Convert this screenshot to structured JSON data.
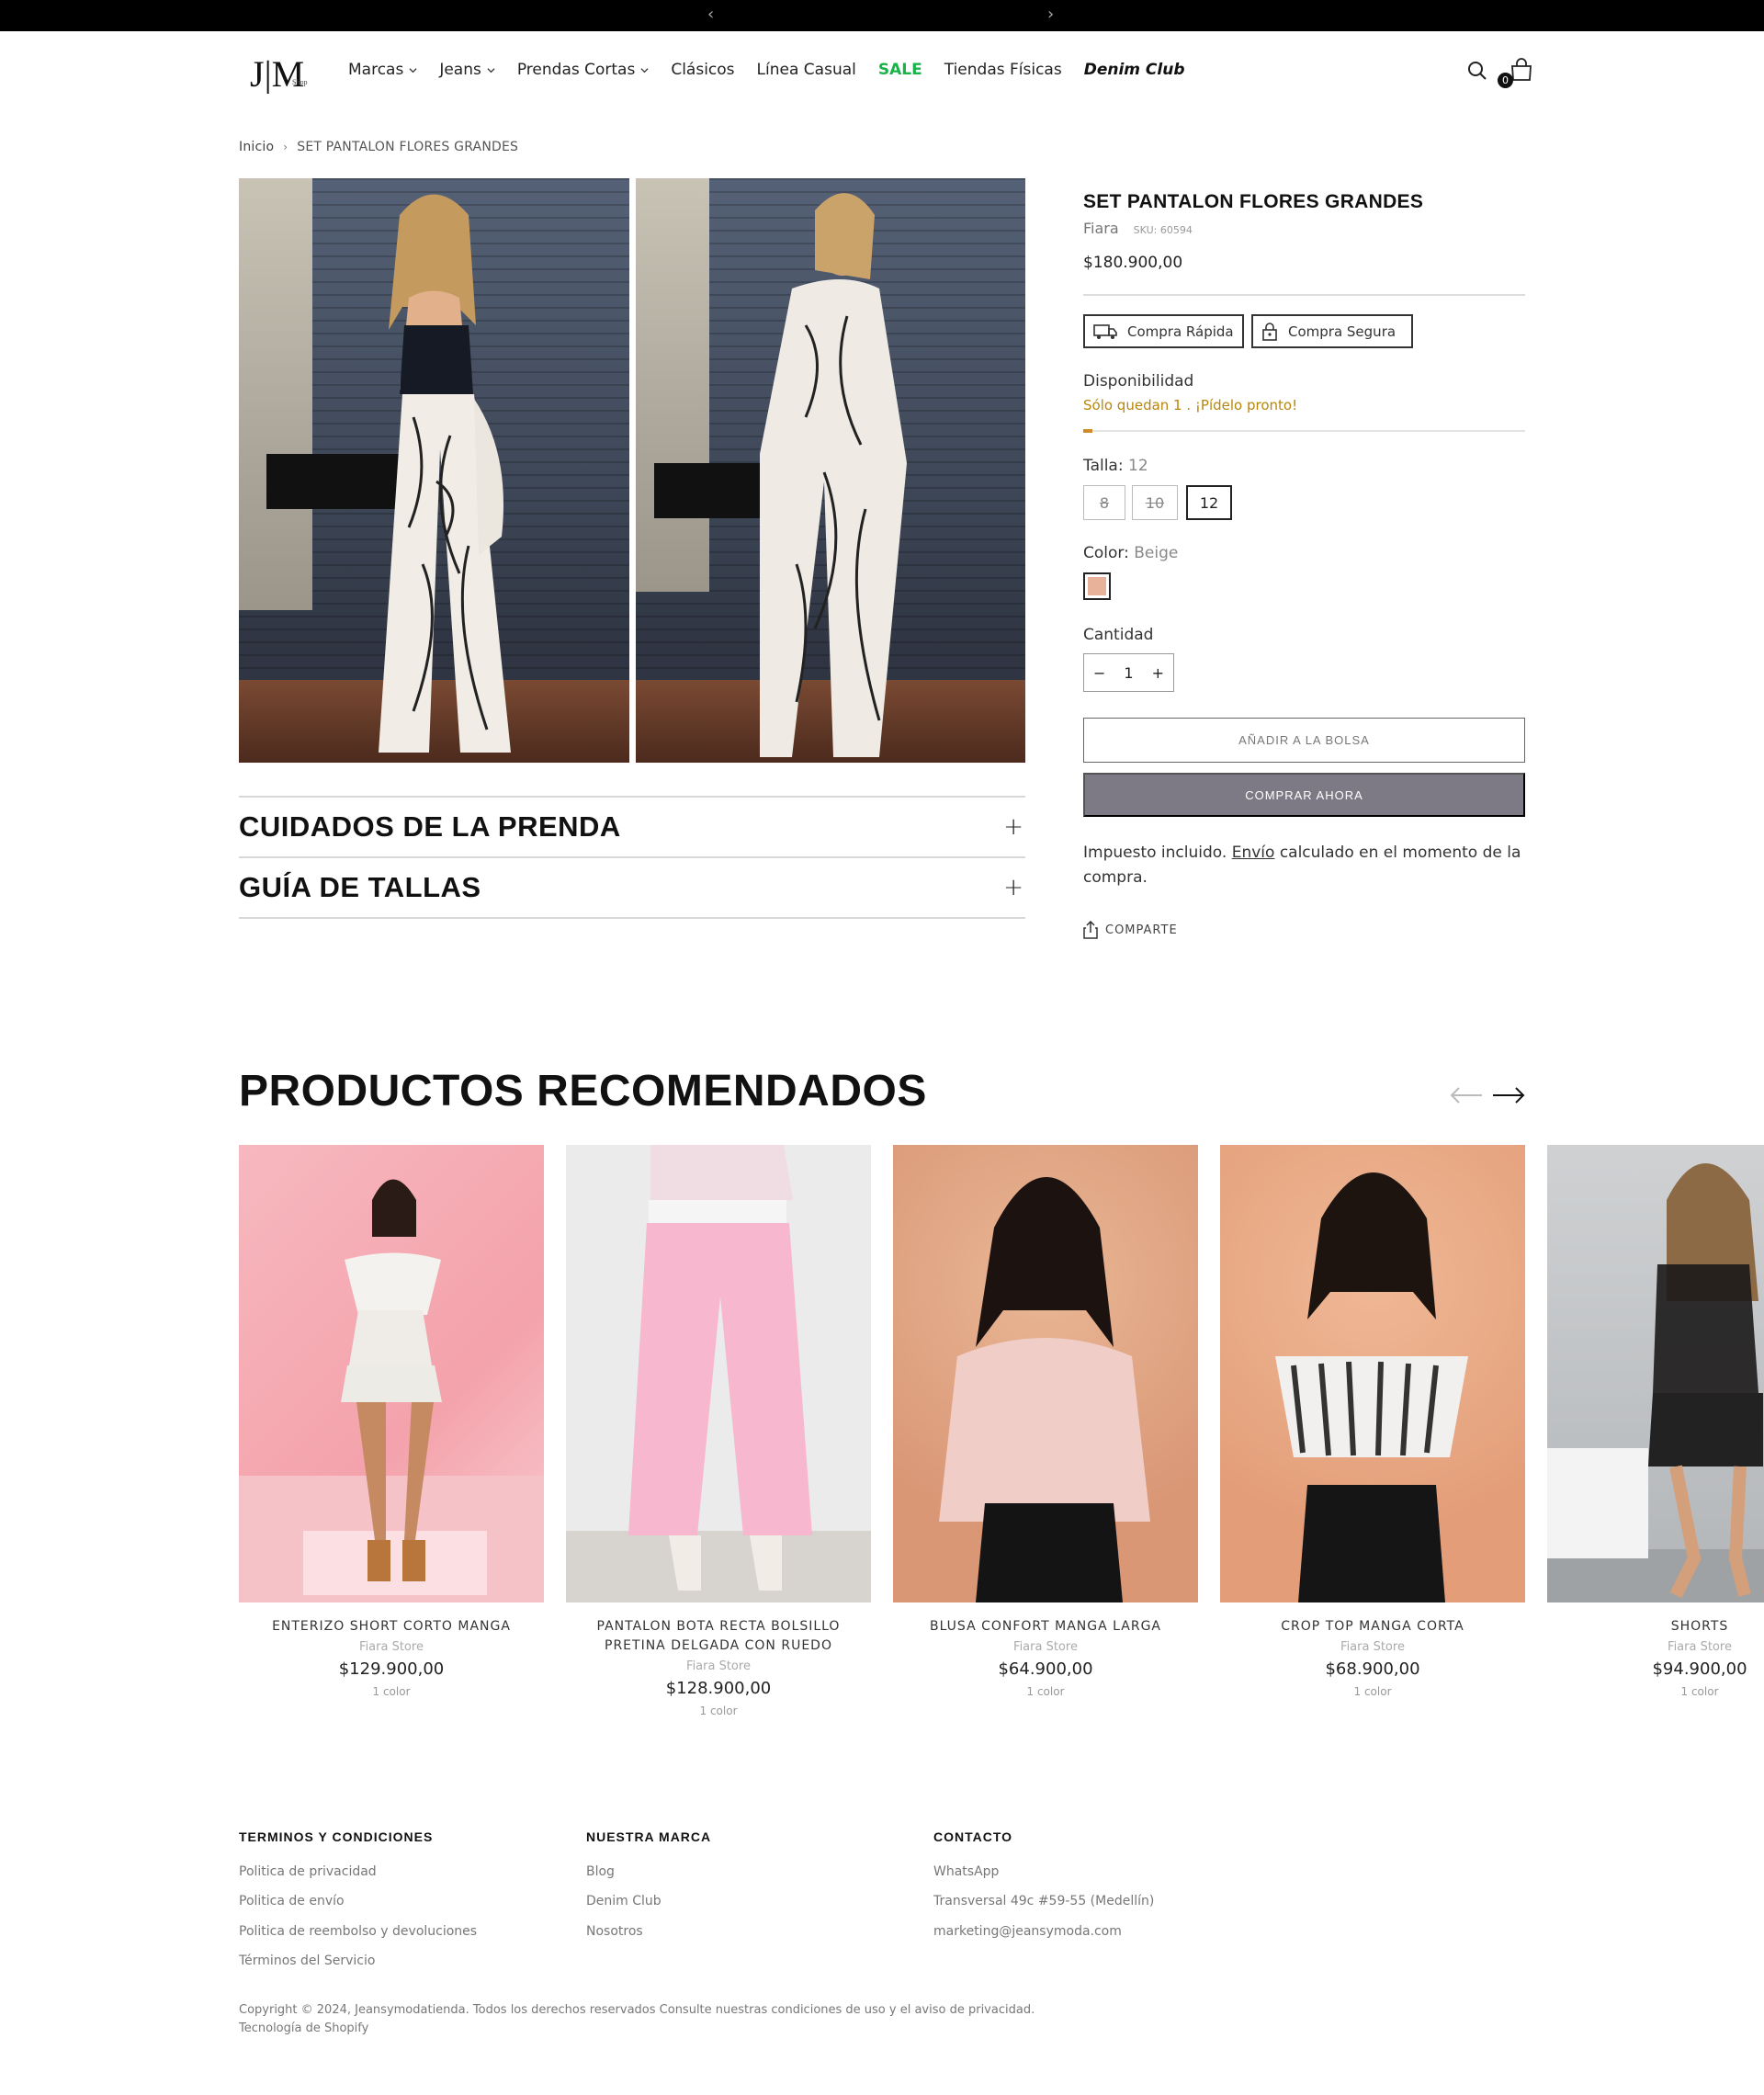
{
  "header": {
    "logo_text": "J|M",
    "logo_sub": "Shop",
    "nav": [
      {
        "label": "Marcas",
        "dropdown": true
      },
      {
        "label": "Jeans",
        "dropdown": true
      },
      {
        "label": "Prendas Cortas",
        "dropdown": true
      },
      {
        "label": "Clásicos",
        "dropdown": false
      },
      {
        "label": "Línea Casual",
        "dropdown": false
      },
      {
        "label": "SALE",
        "dropdown": false
      },
      {
        "label": "Tiendas Físicas",
        "dropdown": false
      },
      {
        "label": "Denim Club",
        "dropdown": false
      }
    ],
    "cart_count": "0",
    "icons": {
      "search": "search-icon",
      "cart": "shopping-bag-icon"
    }
  },
  "breadcrumb": {
    "home": "Inicio",
    "current": "SET PANTALON FLORES GRANDES"
  },
  "product": {
    "title": "SET PANTALON FLORES GRANDES",
    "brand": "Fiara",
    "sku": "SKU: 60594",
    "price": "$180.900,00",
    "badges": [
      "Compra Rápida",
      "Compra Segura"
    ],
    "availability_label": "Disponibilidad",
    "stock_text": "Sólo quedan 1 . ¡Pídelo pronto!",
    "stock_level": 0.02,
    "size_label": "Talla:",
    "size_selected": "12",
    "sizes": [
      {
        "value": "8",
        "available": false
      },
      {
        "value": "10",
        "available": false
      },
      {
        "value": "12",
        "available": true
      }
    ],
    "color_label": "Color:",
    "color_selected": "Beige",
    "swatch_color": "#e7b299",
    "qty_label": "Cantidad",
    "qty_minus": "−",
    "qty_value": "1",
    "qty_plus": "+",
    "add_to_bag": "AÑADIR A LA BOLSA",
    "buy_now": "COMPRAR AHORA",
    "tax_text_1": "Impuesto incluido.",
    "tax_link": "Envío",
    "tax_text_2": "calculado en el momento de la compra.",
    "share": "COMPARTE"
  },
  "accordions": [
    {
      "title": "CUIDADOS DE LA PRENDA",
      "icon": "+"
    },
    {
      "title": "GUÍA DE TALLAS",
      "icon": "+"
    }
  ],
  "recommended": {
    "title": "PRODUCTOS RECOMENDADOS",
    "items": [
      {
        "name": "ENTERIZO SHORT CORTO MANGA",
        "store": "Fiara Store",
        "price": "$129.900,00",
        "colors": "1 color"
      },
      {
        "name": "PANTALON BOTA RECTA BOLSILLO PRETINA DELGADA CON RUEDO",
        "store": "Fiara Store",
        "price": "$128.900,00",
        "colors": "1 color"
      },
      {
        "name": "BLUSA CONFORT MANGA LARGA",
        "store": "Fiara Store",
        "price": "$64.900,00",
        "colors": "1 color"
      },
      {
        "name": "CROP TOP MANGA CORTA",
        "store": "Fiara Store",
        "price": "$68.900,00",
        "colors": "1 color"
      },
      {
        "name": "SHORTS",
        "store": "Fiara Store",
        "price": "$94.900,00",
        "colors": "1 color"
      }
    ]
  },
  "footer": {
    "columns": [
      {
        "title": "TERMINOS Y CONDICIONES",
        "links": [
          "Politica de privacidad",
          "Politica de envío",
          "Politica de reembolso y devoluciones",
          "Términos del Servicio"
        ]
      },
      {
        "title": "NUESTRA MARCA",
        "links": [
          "Blog",
          "Denim Club",
          "Nosotros"
        ]
      },
      {
        "title": "CONTACTO",
        "links": [
          "WhatsApp",
          "Transversal 49c #59-55 (Medellín)",
          "marketing@jeansymoda.com"
        ]
      }
    ],
    "copyright": "Copyright © 2024, Jeansymodatienda. Todos los derechos reservados Consulte nuestras condiciones de uso y el aviso de privacidad.",
    "powered": "Tecnología de Shopify"
  }
}
